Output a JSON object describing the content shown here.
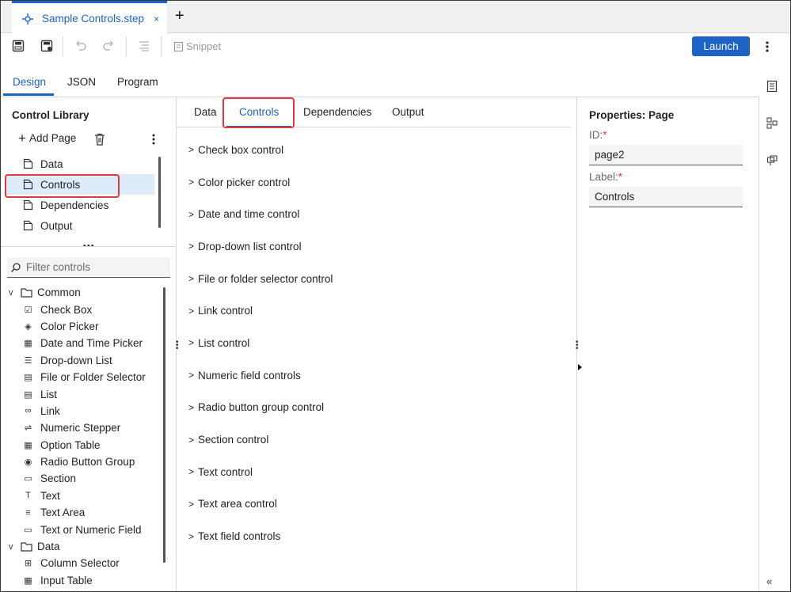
{
  "document_tab": {
    "title": "Sample Controls.step",
    "close": "×",
    "new": "+"
  },
  "toolbar": {
    "snippet": "Snippet",
    "launch": "Launch"
  },
  "view_tabs": [
    {
      "label": "Design",
      "active": true
    },
    {
      "label": "JSON",
      "active": false
    },
    {
      "label": "Program",
      "active": false
    }
  ],
  "library": {
    "title": "Control Library",
    "add_page": "Add Page",
    "pages": [
      {
        "label": "Data",
        "selected": false
      },
      {
        "label": "Controls",
        "selected": true
      },
      {
        "label": "Dependencies",
        "selected": false
      },
      {
        "label": "Output",
        "selected": false
      }
    ],
    "filter_placeholder": "Filter controls",
    "groups": [
      {
        "label": "Common",
        "expanded": true,
        "items": [
          {
            "label": "Check Box",
            "icon": "checkbox-icon"
          },
          {
            "label": "Color Picker",
            "icon": "color-picker-icon"
          },
          {
            "label": "Date and Time Picker",
            "icon": "calendar-icon"
          },
          {
            "label": "Drop-down List",
            "icon": "dropdown-list-icon"
          },
          {
            "label": "File or Folder Selector",
            "icon": "file-selector-icon"
          },
          {
            "label": "List",
            "icon": "list-icon"
          },
          {
            "label": "Link",
            "icon": "link-icon"
          },
          {
            "label": "Numeric Stepper",
            "icon": "numeric-stepper-icon"
          },
          {
            "label": "Option Table",
            "icon": "option-table-icon"
          },
          {
            "label": "Radio Button Group",
            "icon": "radio-group-icon"
          },
          {
            "label": "Section",
            "icon": "section-icon"
          },
          {
            "label": "Text",
            "icon": "text-icon"
          },
          {
            "label": "Text Area",
            "icon": "text-area-icon"
          },
          {
            "label": "Text or Numeric Field",
            "icon": "text-field-icon"
          }
        ]
      },
      {
        "label": "Data",
        "expanded": true,
        "items": [
          {
            "label": "Column Selector",
            "icon": "column-selector-icon"
          },
          {
            "label": "Input Table",
            "icon": "input-table-icon"
          }
        ]
      }
    ]
  },
  "center": {
    "tabs": [
      {
        "label": "Data",
        "active": false
      },
      {
        "label": "Controls",
        "active": true
      },
      {
        "label": "Dependencies",
        "active": false
      },
      {
        "label": "Output",
        "active": false
      }
    ],
    "caret": ">",
    "sections": [
      "Check box control",
      "Color picker control",
      "Date and time control",
      "Drop-down list control",
      "File or folder selector control",
      "Link control",
      "List control",
      "Numeric field controls",
      "Radio button group control",
      "Section control",
      "Text control",
      "Text area control",
      "Text field controls"
    ]
  },
  "properties": {
    "title": "Properties: Page",
    "id_label": "ID:",
    "id_value": "page2",
    "label_label": "Label:",
    "label_value": "Controls",
    "required_mark": "*"
  },
  "colors": {
    "accent": "#1d63c6",
    "highlight": "#e0393e",
    "selected_bg": "#deebfb"
  }
}
